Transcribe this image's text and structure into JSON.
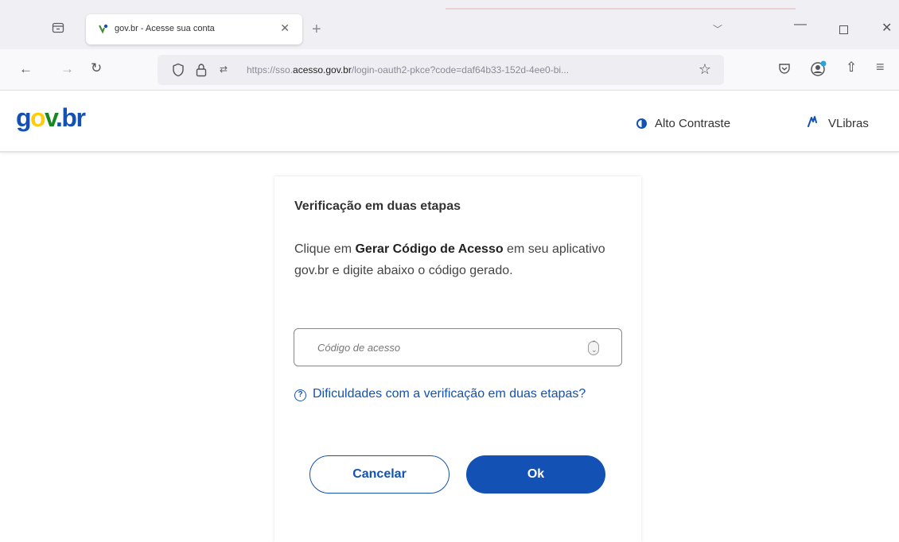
{
  "browser": {
    "tab_title": "gov.br - Acesse sua conta",
    "tab_favicon": "gov-favicon-icon",
    "url_prefix": "https://sso.",
    "url_host": "acesso.gov.br",
    "url_path": "/login-oauth2-pkce?code=daf64b33-152d-4ee0-bi...",
    "icons": [
      "tab-list-icon",
      "close-tab-icon",
      "new-tab-icon",
      "tab-overflow-icon",
      "minimize-icon",
      "maximize-icon",
      "close-window-icon",
      "back-icon",
      "forward-icon",
      "reload-icon",
      "shield-icon",
      "lock-icon",
      "permissions-icon",
      "star-icon",
      "pocket-icon",
      "account-icon",
      "extensions-icon",
      "menu-icon"
    ]
  },
  "site": {
    "logo": {
      "g": "g",
      "o": "o",
      "v": "v",
      "dot": ".",
      "b": "b",
      "r": "r"
    },
    "high_contrast_label": "Alto Contraste",
    "vlibras_label": "VLibras",
    "brand_colors": {
      "blue": "#1351b4",
      "yellow": "#ffcd07",
      "green": "#168821"
    }
  },
  "card": {
    "title": "Verificação em duas etapas",
    "desc_pre": "Clique em ",
    "desc_bold": "Gerar Código de Acesso",
    "desc_post": " em seu aplicativo gov.br e digite abaixo o código gerado.",
    "code_placeholder": "Código de acesso",
    "code_value": "",
    "help_link": "Dificuldades com a verificação em duas etapas?",
    "cancel_label": "Cancelar",
    "ok_label": "Ok"
  }
}
